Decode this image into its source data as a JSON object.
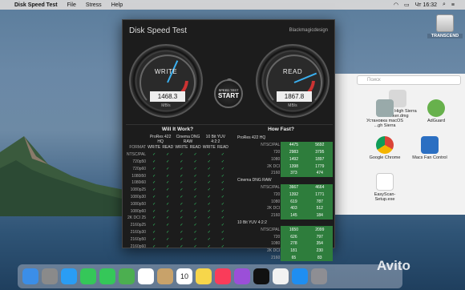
{
  "menubar": {
    "app_name": "Disk Speed Test",
    "menus": [
      "File",
      "Stress",
      "Help"
    ],
    "clock": "Чт 16:32"
  },
  "desktop": {
    "drive_label": "TRANSCEND"
  },
  "finder": {
    "search_placeholder": "Поиск",
    "items": [
      {
        "label": "macOS High Sierra P...ker.dmg",
        "icon": "dmg-icon"
      },
      {
        "label": "AdGuard",
        "icon": "adguard-icon"
      },
      {
        "label": "Установка macOS ...gh Sierra",
        "icon": "installer-icon"
      },
      {
        "label": "Google Chrome",
        "icon": "chrome-icon"
      },
      {
        "label": "Macs Fan Control",
        "icon": "fan-icon"
      },
      {
        "label": "EasyScan-Setup.exe",
        "icon": "document-icon"
      }
    ]
  },
  "app": {
    "title": "Disk Speed Test",
    "brand": "Blackmagicdesign",
    "write_label": "WRITE",
    "write_value": "1468.3",
    "read_label": "READ",
    "read_value": "1867.8",
    "unit": "MB/s",
    "start_small": "SPEED TEST",
    "start_big": "START",
    "write_fraction": 0.59,
    "read_fraction": 0.75
  },
  "will_it_work": {
    "title": "Will It Work?",
    "groups": [
      "ProRes 422 HQ",
      "Cinema DNG RAW",
      "10 Bit YUV 4:2:2"
    ],
    "subheaders": [
      "FORMAT",
      "WRITE",
      "READ"
    ],
    "formats": [
      "NTSC/PAL",
      "720p50",
      "720p60",
      "1080i50",
      "1080i60",
      "1080p25",
      "1080p30",
      "1080p50",
      "1080p60",
      "2K DCI 25",
      "2160p25",
      "2160p30",
      "2160p50",
      "2160p60"
    ],
    "check_mark": "✓"
  },
  "how_fast": {
    "title": "How Fast?",
    "sections": [
      {
        "name": "ProRes 422 HQ",
        "rows": [
          [
            "NTSC/PAL",
            "4475",
            "5692"
          ],
          [
            "720",
            "2983",
            "3795"
          ],
          [
            "1080",
            "1492",
            "1897"
          ],
          [
            "2K DCI",
            "1398",
            "1779"
          ],
          [
            "2160",
            "373",
            "474"
          ]
        ]
      },
      {
        "name": "Cinema DNG RAW",
        "rows": [
          [
            "NTSC/PAL",
            "3667",
            "4664"
          ],
          [
            "720",
            "1392",
            "1771"
          ],
          [
            "1080",
            "619",
            "787"
          ],
          [
            "2K DCI",
            "403",
            "512"
          ],
          [
            "2160",
            "145",
            "184"
          ]
        ]
      },
      {
        "name": "10 Bit YUV 4:2:2",
        "rows": [
          [
            "NTSC/PAL",
            "1650",
            "2099"
          ],
          [
            "720",
            "626",
            "797"
          ],
          [
            "1080",
            "278",
            "354"
          ],
          [
            "2K DCI",
            "181",
            "230"
          ],
          [
            "2160",
            "65",
            "83"
          ]
        ]
      }
    ]
  },
  "dock": {
    "items": [
      "finder-icon",
      "launchpad-icon",
      "safari-icon",
      "messages-icon",
      "facetime-icon",
      "maps-icon",
      "photos-icon",
      "contacts-icon",
      "calendar-icon",
      "notes-icon",
      "music-icon",
      "podcasts-icon",
      "tv-icon",
      "news-icon",
      "appstore-icon",
      "preferences-icon"
    ],
    "calendar_day": "10"
  },
  "watermark": "Avito"
}
